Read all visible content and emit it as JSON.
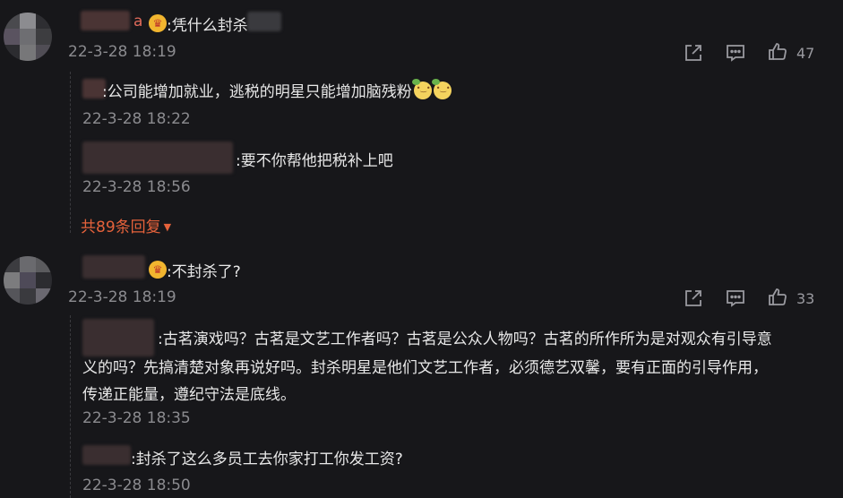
{
  "comments": [
    {
      "username_visible": "a",
      "text": ":凭什么封杀",
      "time": "22-3-28 18:19",
      "like_count": "47",
      "replies": [
        {
          "text": ":公司能增加就业，逃税的明星只能增加脑残粉",
          "time": "22-3-28 18:22",
          "emoji_count": 2
        },
        {
          "text": ":要不你帮他把税补上吧",
          "time": "22-3-28 18:56"
        }
      ],
      "more_replies_label": "共89条回复"
    },
    {
      "text": ":不封杀了?",
      "time": "22-3-28 18:19",
      "like_count": "33",
      "replies": [
        {
          "lines": [
            ":古茗演戏吗？古茗是文艺工作者吗？古茗是公众人物吗？古茗的所作所为是对观众有引导意",
            "义的吗？先搞清楚对象再说好吗。封杀明星是他们文艺工作者，必须德艺双馨，要有正面的引导作用，",
            "传递正能量，遵纪守法是底线。"
          ],
          "time": "22-3-28 18:35"
        },
        {
          "text": ":封杀了这么多员工去你家打工你发工资?",
          "time": "22-3-28 18:50"
        }
      ]
    }
  ],
  "icons": {
    "share": "share-icon",
    "comment": "comment-icon",
    "like": "thumbs-up-icon",
    "crown": "crown-icon",
    "expand": "caret-down-icon",
    "emoji": "smile-emoji-icon"
  },
  "colors": {
    "background": "#17171a",
    "accent": "#e5623b",
    "muted": "#8b8b8f",
    "crown": "#f1b52f"
  }
}
